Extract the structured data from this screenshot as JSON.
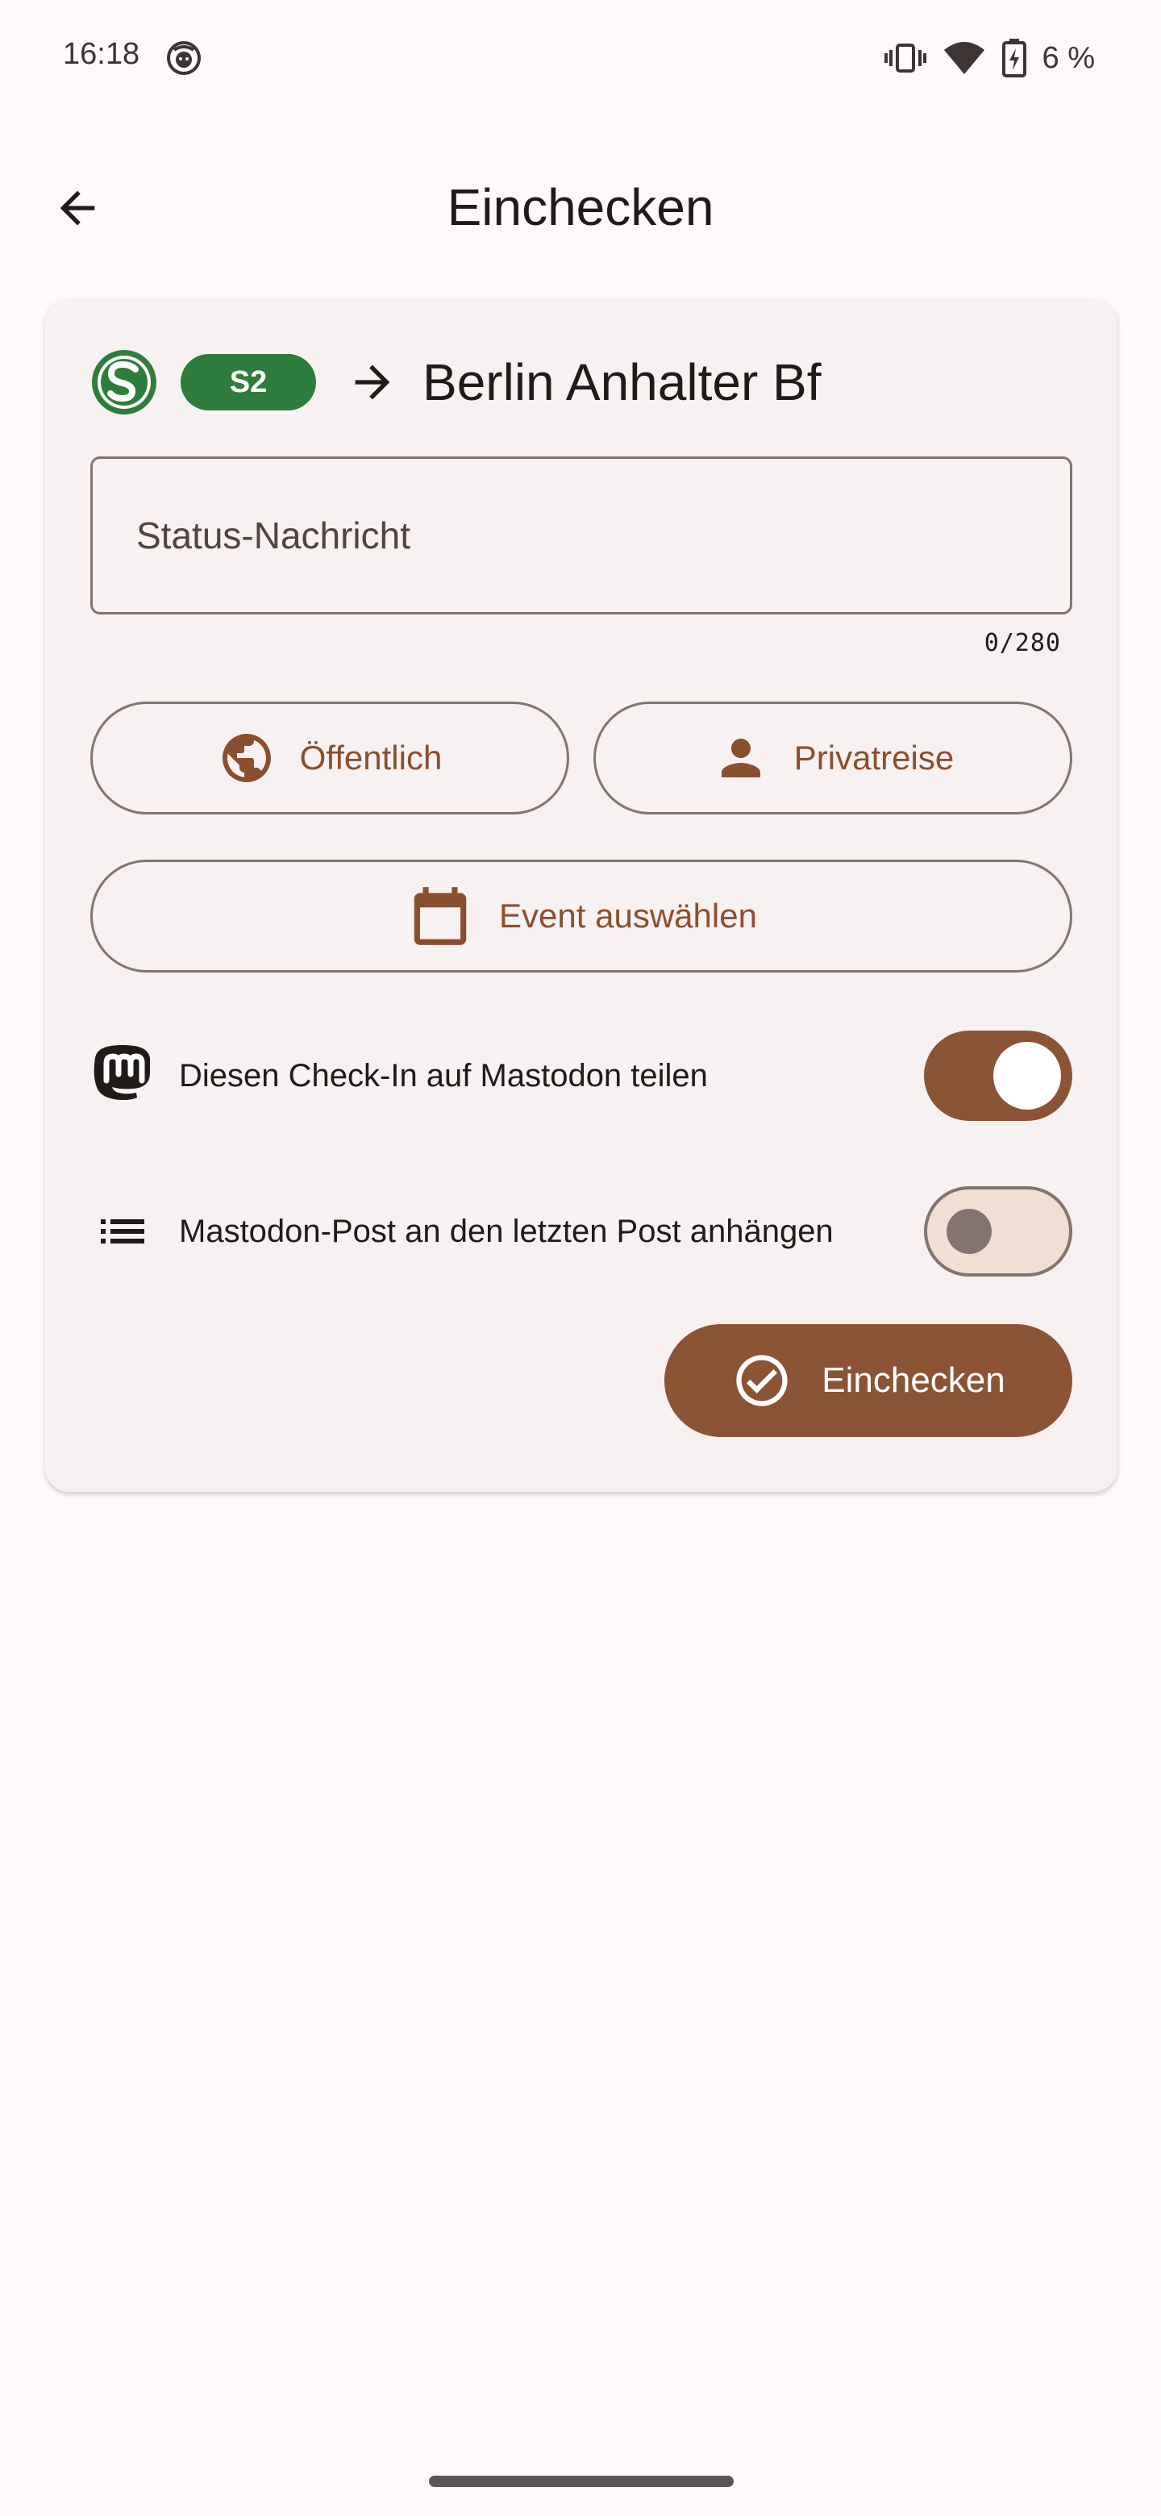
{
  "status_bar": {
    "time": "16:18",
    "battery_text": "6 %"
  },
  "app_bar": {
    "title": "Einchecken",
    "back_icon": "arrow-back-icon"
  },
  "trip": {
    "operator_logo": "s-bahn-logo",
    "line": "S2",
    "destination": "Berlin Anhalter Bf",
    "line_color": "#2e7d3c"
  },
  "status_message": {
    "placeholder": "Status-Nachricht",
    "value": "",
    "counter": "0/280"
  },
  "visibility_button": {
    "label": "Öffentlich",
    "icon": "globe-icon"
  },
  "travel_type_button": {
    "label": "Privatreise",
    "icon": "person-icon"
  },
  "event_button": {
    "label": "Event auswählen",
    "icon": "calendar-icon"
  },
  "settings": {
    "share_mastodon": {
      "label": "Diesen Check-In auf Mastodon teilen",
      "enabled": true,
      "icon": "mastodon-icon"
    },
    "append_post": {
      "label": "Mastodon-Post an den letzten Post anhängen",
      "enabled": false,
      "icon": "list-icon"
    }
  },
  "checkin_button": {
    "label": "Einchecken",
    "icon": "check-circle-icon"
  },
  "colors": {
    "primary": "#8a5435",
    "background": "#fdf8fb",
    "card": "#f7f1f1",
    "outline": "#85736f"
  }
}
